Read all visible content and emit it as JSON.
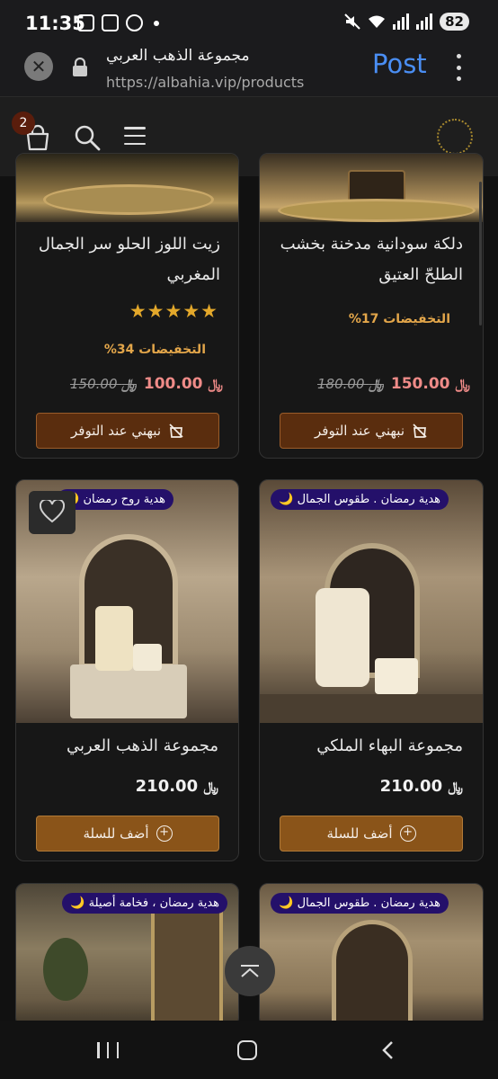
{
  "status_bar": {
    "time": "11:35",
    "battery": "82"
  },
  "browser": {
    "title": "مجموعة الذهب العربي",
    "url": "https://albahia.vip/products",
    "post_label": "Post"
  },
  "header": {
    "cart_count": "2"
  },
  "currency_symbol": "﷼",
  "products": [
    {
      "name": "زيت اللوز الحلو سر الجمال المغربي",
      "stars": "★★★★★",
      "rating": 5,
      "discount": "التخفيضات 34%",
      "old_price": "150.00",
      "price": "100.00",
      "button": "نبهني عند التوفر"
    },
    {
      "name": "دلكة سودانية مدخنة بخشب الطلحّ العتيق",
      "discount": "التخفيضات 17%",
      "old_price": "180.00",
      "price": "150.00",
      "button": "نبهني عند التوفر"
    },
    {
      "name": "مجموعة الذهب العربي",
      "tag": "هدية روح رمضان 🌙",
      "price": "210.00",
      "button": "أضف للسلة"
    },
    {
      "name": "مجموعة البهاء الملكي",
      "tag": "هدية رمضان . طقوس الجمال 🌙",
      "price": "210.00",
      "button": "أضف للسلة"
    },
    {
      "tag": "هدية رمضان ، فخامة أصيلة 🌙"
    },
    {
      "tag": "هدية رمضان . طقوس الجمال 🌙"
    }
  ]
}
